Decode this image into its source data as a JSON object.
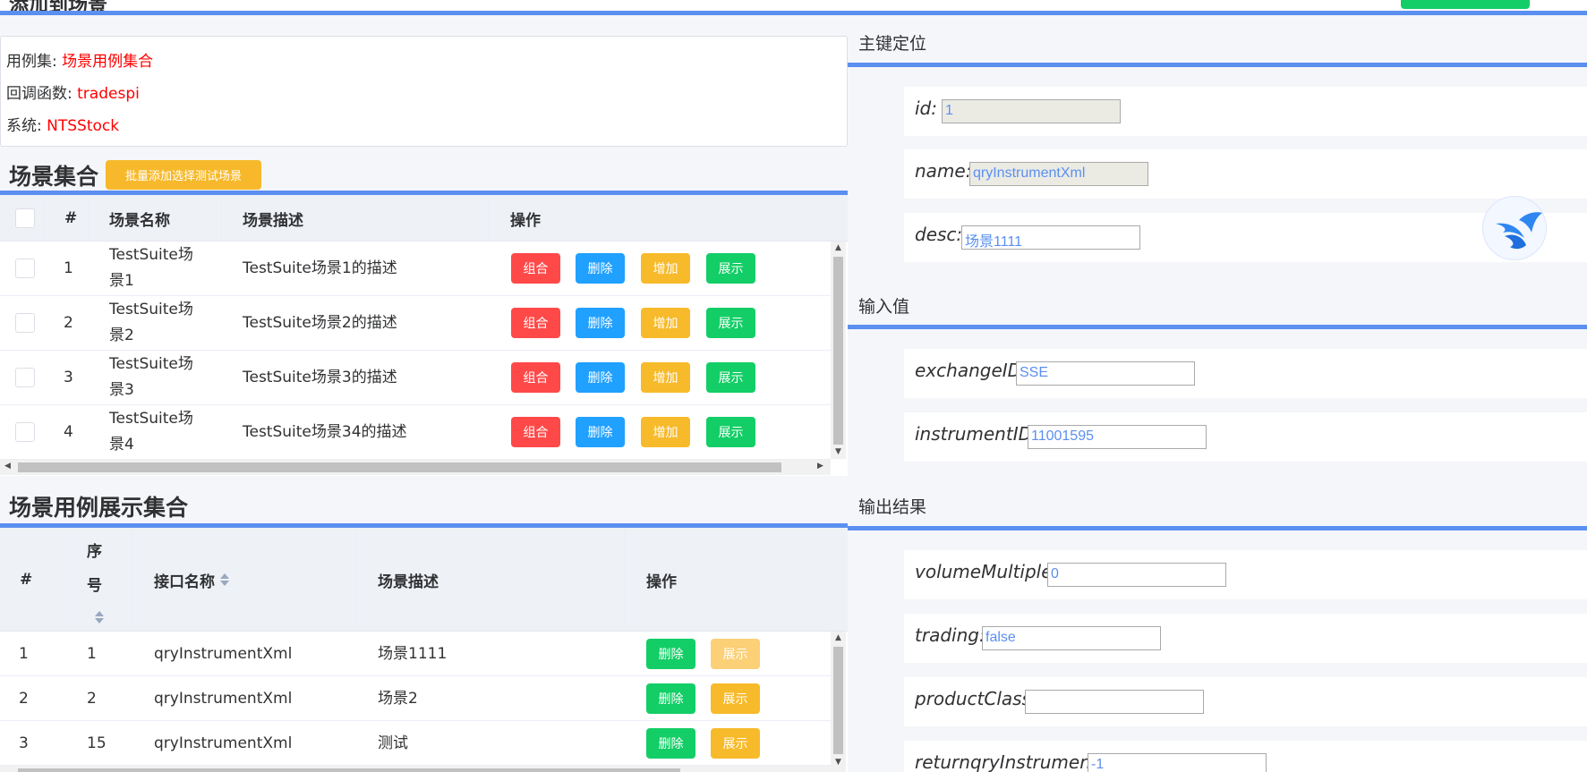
{
  "header": {
    "title": "添加到场景"
  },
  "info": {
    "suite_label": "用例集: ",
    "suite_value": "场景用例集合",
    "callback_label": "回调函数: ",
    "callback_value": "tradespi",
    "system_label": "系统: ",
    "system_value": "NTSStock"
  },
  "scene_set": {
    "title": "场景集合",
    "batch_button": "批量添加选择测试场景",
    "columns": [
      "#",
      "场景名称",
      "场景描述",
      "操作"
    ],
    "rows": [
      {
        "num": "1",
        "name_line1": "TestSuite场",
        "name_line2": "景1",
        "desc": "TestSuite场景1的描述"
      },
      {
        "num": "2",
        "name_line1": "TestSuite场",
        "name_line2": "景2",
        "desc": "TestSuite场景2的描述"
      },
      {
        "num": "3",
        "name_line1": "TestSuite场",
        "name_line2": "景3",
        "desc": "TestSuite场景3的描述"
      },
      {
        "num": "4",
        "name_line1": "TestSuite场",
        "name_line2": "景4",
        "desc": "TestSuite场景34的描述"
      }
    ],
    "actions": {
      "combine": "组合",
      "delete": "删除",
      "add": "增加",
      "show": "展示"
    }
  },
  "case_set": {
    "title": "场景用例展示集合",
    "columns": {
      "hash": "#",
      "seq_line1": "序",
      "seq_line2": "号",
      "api_name": "接口名称",
      "desc": "场景描述",
      "ops": "操作"
    },
    "rows": [
      {
        "num": "1",
        "seq": "1",
        "api": "qryInstrumentXml",
        "desc": "场景1111"
      },
      {
        "num": "2",
        "seq": "2",
        "api": "qryInstrumentXml",
        "desc": "场景2"
      },
      {
        "num": "3",
        "seq": "15",
        "api": "qryInstrumentXml",
        "desc": "测试"
      }
    ],
    "actions": {
      "delete": "删除",
      "show": "展示"
    }
  },
  "right": {
    "pk_title": "主键定位",
    "pk_fields": [
      {
        "label": "id:",
        "value": "1"
      },
      {
        "label": "name:",
        "value": "qryInstrumentXml"
      },
      {
        "label": "desc:",
        "value": "场景1111"
      }
    ],
    "input_title": "输入值",
    "input_fields": [
      {
        "label": "exchangeID:",
        "value": "SSE"
      },
      {
        "label": "instrumentID:",
        "value": "11001595"
      }
    ],
    "output_title": "输出结果",
    "output_fields": [
      {
        "label": "volumeMultiple:",
        "value": "0"
      },
      {
        "label": "trading:",
        "value": "false"
      },
      {
        "label": "productClass:",
        "value": ""
      },
      {
        "label": "returnqryInstrument:",
        "value": "-1"
      }
    ]
  },
  "colors": {
    "accent": "#5b8ff0",
    "red": "#ff4949",
    "blue": "#20a0ff",
    "yellow": "#f7ba2a",
    "green": "#13ce66"
  }
}
